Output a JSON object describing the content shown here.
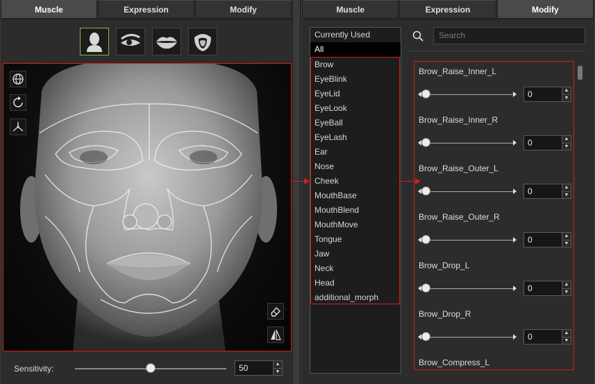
{
  "left_tabs": [
    "Muscle",
    "Expression",
    "Modify"
  ],
  "right_tabs": [
    "Muscle",
    "Expression",
    "Modify"
  ],
  "category_buttons": [
    "head-icon",
    "eye-icon",
    "lips-icon",
    "tongue-icon"
  ],
  "viewport_tools": [
    "orbit-icon",
    "rotate-icon",
    "axis-icon",
    "eraser-icon",
    "mirror-icon"
  ],
  "sensitivity": {
    "label": "Sensitivity:",
    "value": "50",
    "level": 0.5
  },
  "list": {
    "header": "Currently Used",
    "selected": "All",
    "items": [
      "Brow",
      "EyeBlink",
      "EyeLid",
      "EyeLook",
      "EyeBall",
      "EyeLash",
      "Ear",
      "Nose",
      "Cheek",
      "MouthBase",
      "MouthBlend",
      "MouthMove",
      "Tongue",
      "Jaw",
      "Neck",
      "Head",
      "additional_morph"
    ]
  },
  "search": {
    "placeholder": "Search"
  },
  "params": [
    {
      "name": "Brow_Raise_Inner_L",
      "value": "0",
      "level": 0
    },
    {
      "name": "Brow_Raise_Inner_R",
      "value": "0",
      "level": 0
    },
    {
      "name": "Brow_Raise_Outer_L",
      "value": "0",
      "level": 0
    },
    {
      "name": "Brow_Raise_Outer_R",
      "value": "0",
      "level": 0
    },
    {
      "name": "Brow_Drop_L",
      "value": "0",
      "level": 0
    },
    {
      "name": "Brow_Drop_R",
      "value": "0",
      "level": 0
    },
    {
      "name": "Brow_Compress_L",
      "value": "",
      "level": 0
    }
  ],
  "colors": {
    "highlight": "#d51f1f",
    "selected_button": "#8ab83c"
  }
}
